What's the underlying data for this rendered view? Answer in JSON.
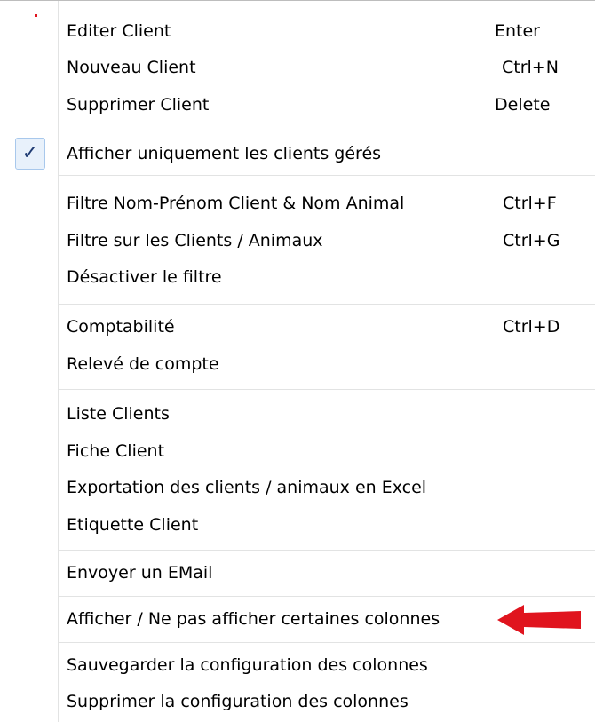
{
  "menu": {
    "items": [
      {
        "label": "Editer Client",
        "shortcut": "Enter"
      },
      {
        "label": "Nouveau Client",
        "shortcut": "Ctrl+N"
      },
      {
        "label": "Supprimer Client",
        "shortcut": "Delete"
      },
      {
        "label": "Afficher uniquement les clients gérés",
        "shortcut": "",
        "checked": true
      },
      {
        "label": "Filtre Nom-Prénom Client & Nom Animal",
        "shortcut": "Ctrl+F"
      },
      {
        "label": "Filtre sur les Clients / Animaux",
        "shortcut": "Ctrl+G"
      },
      {
        "label": "Désactiver le filtre",
        "shortcut": ""
      },
      {
        "label": "Comptabilité",
        "shortcut": "Ctrl+D"
      },
      {
        "label": "Relevé de compte",
        "shortcut": ""
      },
      {
        "label": "Liste Clients",
        "shortcut": ""
      },
      {
        "label": "Fiche Client",
        "shortcut": ""
      },
      {
        "label": "Exportation des clients / animaux en Excel",
        "shortcut": ""
      },
      {
        "label": "Etiquette Client",
        "shortcut": ""
      },
      {
        "label": "Envoyer un EMail",
        "shortcut": ""
      },
      {
        "label": "Afficher / Ne pas afficher certaines colonnes",
        "shortcut": ""
      },
      {
        "label": "Sauvegarder la configuration des colonnes",
        "shortcut": ""
      },
      {
        "label": "Supprimer la configuration des colonnes",
        "shortcut": ""
      }
    ],
    "check_glyph": "✓"
  },
  "colors": {
    "annotation_arrow": "#e0141e",
    "check_highlight": "#e8f1fb",
    "separator": "#e2e3e3"
  },
  "icons": {
    "check": "checkmark-icon",
    "annotation": "red-arrow-annotation"
  }
}
